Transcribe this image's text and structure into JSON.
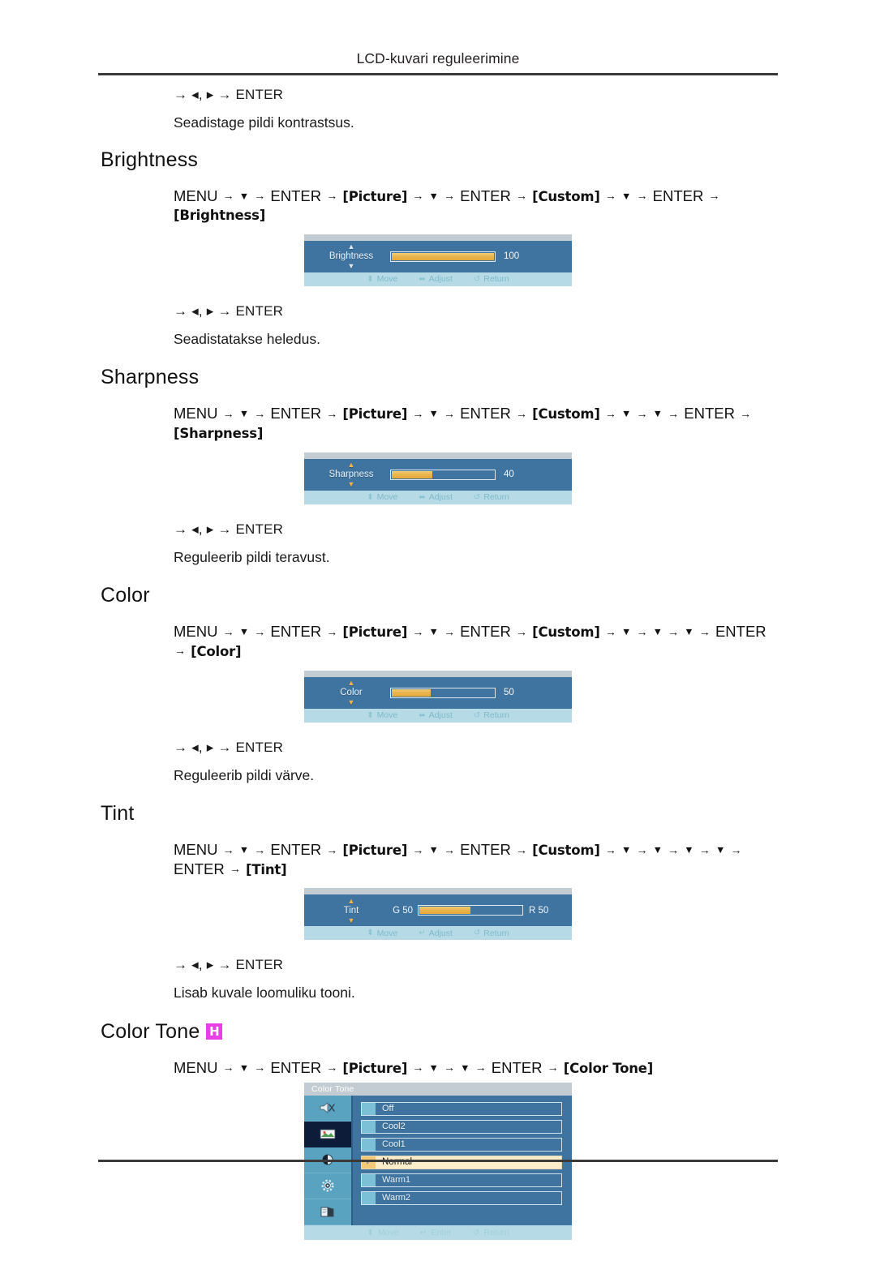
{
  "header": {
    "title": "LCD-kuvari reguleerimine"
  },
  "intro": {
    "keys": "→ ◂, ▸ → ENTER",
    "description": "Seadistage pildi kontrastsus."
  },
  "sections": [
    {
      "id": "brightness",
      "title": "Brightness",
      "badge": "",
      "path_tokens": [
        {
          "t": "MENU",
          "k": "plain"
        },
        {
          "t": "→",
          "k": "arrow"
        },
        {
          "t": "▼",
          "k": "tri"
        },
        {
          "t": "→",
          "k": "arrow"
        },
        {
          "t": "ENTER",
          "k": "plain"
        },
        {
          "t": "→",
          "k": "arrow"
        },
        {
          "t": "[Picture]",
          "k": "bracket"
        },
        {
          "t": "→",
          "k": "arrow"
        },
        {
          "t": "▼",
          "k": "tri"
        },
        {
          "t": "→",
          "k": "arrow"
        },
        {
          "t": "ENTER",
          "k": "plain"
        },
        {
          "t": "→",
          "k": "arrow"
        },
        {
          "t": "[Custom]",
          "k": "bracket"
        },
        {
          "t": "→",
          "k": "arrow"
        },
        {
          "t": "▼",
          "k": "tri"
        },
        {
          "t": "→",
          "k": "arrow"
        },
        {
          "t": "ENTER",
          "k": "plain"
        },
        {
          "t": "→",
          "k": "arrow"
        },
        {
          "t": "[Brightness]",
          "k": "bracket"
        }
      ],
      "osd": {
        "type": "slider",
        "label": "Brightness",
        "value": "100",
        "fill_percent": 100,
        "footer": [
          {
            "glyph": "⬍",
            "label": "Move"
          },
          {
            "glyph": "⬌",
            "label": "Adjust"
          },
          {
            "glyph": "↺",
            "label": "Return"
          }
        ]
      },
      "keys": "→ ◂, ▸ → ENTER",
      "description": "Seadistatakse heledus."
    },
    {
      "id": "sharpness",
      "title": "Sharpness",
      "badge": "",
      "path_tokens": [
        {
          "t": "MENU",
          "k": "plain"
        },
        {
          "t": "→",
          "k": "arrow"
        },
        {
          "t": "▼",
          "k": "tri"
        },
        {
          "t": "→",
          "k": "arrow"
        },
        {
          "t": "ENTER",
          "k": "plain"
        },
        {
          "t": "→",
          "k": "arrow"
        },
        {
          "t": "[Picture]",
          "k": "bracket"
        },
        {
          "t": "→",
          "k": "arrow"
        },
        {
          "t": "▼",
          "k": "tri"
        },
        {
          "t": "→",
          "k": "arrow"
        },
        {
          "t": "ENTER",
          "k": "plain"
        },
        {
          "t": "→",
          "k": "arrow"
        },
        {
          "t": "[Custom]",
          "k": "bracket"
        },
        {
          "t": "→",
          "k": "arrow"
        },
        {
          "t": "▼",
          "k": "tri"
        },
        {
          "t": "→",
          "k": "arrow"
        },
        {
          "t": "▼",
          "k": "tri"
        },
        {
          "t": "→",
          "k": "arrow"
        },
        {
          "t": "ENTER",
          "k": "plain"
        },
        {
          "t": "→",
          "k": "arrow"
        },
        {
          "t": "[Sharpness]",
          "k": "bracket"
        }
      ],
      "osd": {
        "type": "slider",
        "label": "Sharpness",
        "value": "40",
        "fill_percent": 40,
        "footer": [
          {
            "glyph": "⬍",
            "label": "Move"
          },
          {
            "glyph": "⬌",
            "label": "Adjust"
          },
          {
            "glyph": "↺",
            "label": "Return"
          }
        ]
      },
      "keys": "→ ◂, ▸ → ENTER",
      "description": "Reguleerib pildi teravust."
    },
    {
      "id": "color",
      "title": "Color",
      "badge": "",
      "path_tokens": [
        {
          "t": "MENU",
          "k": "plain"
        },
        {
          "t": "→",
          "k": "arrow"
        },
        {
          "t": "▼",
          "k": "tri"
        },
        {
          "t": "→",
          "k": "arrow"
        },
        {
          "t": "ENTER",
          "k": "plain"
        },
        {
          "t": "→",
          "k": "arrow"
        },
        {
          "t": "[Picture]",
          "k": "bracket"
        },
        {
          "t": "→",
          "k": "arrow"
        },
        {
          "t": "▼",
          "k": "tri"
        },
        {
          "t": "→",
          "k": "arrow"
        },
        {
          "t": "ENTER",
          "k": "plain"
        },
        {
          "t": "→",
          "k": "arrow"
        },
        {
          "t": "[Custom]",
          "k": "bracket"
        },
        {
          "t": "→",
          "k": "arrow"
        },
        {
          "t": "▼",
          "k": "tri"
        },
        {
          "t": "→",
          "k": "arrow"
        },
        {
          "t": "▼",
          "k": "tri"
        },
        {
          "t": "→",
          "k": "arrow"
        },
        {
          "t": "▼",
          "k": "tri"
        },
        {
          "t": "→",
          "k": "arrow"
        },
        {
          "t": "ENTER",
          "k": "plain"
        },
        {
          "t": "→",
          "k": "arrow"
        },
        {
          "t": "[Color]",
          "k": "bracket"
        }
      ],
      "osd": {
        "type": "slider",
        "label": "Color",
        "value": "50",
        "fill_percent": 38,
        "footer": [
          {
            "glyph": "⬍",
            "label": "Move"
          },
          {
            "glyph": "⬌",
            "label": "Adjust"
          },
          {
            "glyph": "↺",
            "label": "Return"
          }
        ]
      },
      "keys": "→ ◂, ▸ → ENTER",
      "description": "Reguleerib pildi värve."
    },
    {
      "id": "tint",
      "title": "Tint",
      "badge": "",
      "path_tokens": [
        {
          "t": "MENU",
          "k": "plain"
        },
        {
          "t": "→",
          "k": "arrow"
        },
        {
          "t": "▼",
          "k": "tri"
        },
        {
          "t": "→",
          "k": "arrow"
        },
        {
          "t": "ENTER",
          "k": "plain"
        },
        {
          "t": "→",
          "k": "arrow"
        },
        {
          "t": "[Picture]",
          "k": "bracket"
        },
        {
          "t": "→",
          "k": "arrow"
        },
        {
          "t": "▼",
          "k": "tri"
        },
        {
          "t": "→",
          "k": "arrow"
        },
        {
          "t": "ENTER",
          "k": "plain"
        },
        {
          "t": "→",
          "k": "arrow"
        },
        {
          "t": "[Custom]",
          "k": "bracket"
        },
        {
          "t": "→",
          "k": "arrow"
        },
        {
          "t": "▼",
          "k": "tri"
        },
        {
          "t": "→",
          "k": "arrow"
        },
        {
          "t": "▼",
          "k": "tri"
        },
        {
          "t": "→",
          "k": "arrow"
        },
        {
          "t": "▼",
          "k": "tri"
        },
        {
          "t": "→",
          "k": "arrow"
        },
        {
          "t": "▼",
          "k": "tri"
        },
        {
          "t": "→",
          "k": "arrow"
        },
        {
          "t": "ENTER",
          "k": "plain"
        },
        {
          "t": "→",
          "k": "arrow"
        },
        {
          "t": "[Tint]",
          "k": "bracket"
        }
      ],
      "osd": {
        "type": "dual-slider",
        "label": "Tint",
        "left_label": "G 50",
        "right_label": "R 50",
        "fill_percent": 50,
        "footer": [
          {
            "glyph": "⬍",
            "label": "Move"
          },
          {
            "glyph": "↵",
            "label": "Adjust"
          },
          {
            "glyph": "↺",
            "label": "Return"
          }
        ]
      },
      "keys": "→ ◂, ▸ → ENTER",
      "description": "Lisab kuvale loomuliku tooni."
    },
    {
      "id": "color-tone",
      "title": "Color Tone",
      "badge": "H",
      "badge_color": "#e83fe8",
      "path_tokens": [
        {
          "t": "MENU",
          "k": "plain"
        },
        {
          "t": "→",
          "k": "arrow"
        },
        {
          "t": "▼",
          "k": "tri"
        },
        {
          "t": "→",
          "k": "arrow"
        },
        {
          "t": "ENTER",
          "k": "plain"
        },
        {
          "t": "→",
          "k": "arrow"
        },
        {
          "t": "[Picture]",
          "k": "bracket"
        },
        {
          "t": "→",
          "k": "arrow"
        },
        {
          "t": "▼",
          "k": "tri"
        },
        {
          "t": "→",
          "k": "arrow"
        },
        {
          "t": "▼",
          "k": "tri"
        },
        {
          "t": "→",
          "k": "arrow"
        },
        {
          "t": "ENTER",
          "k": "plain"
        },
        {
          "t": "→",
          "k": "arrow"
        },
        {
          "t": "[Color Tone]",
          "k": "bracket"
        }
      ],
      "osd": {
        "type": "menu",
        "title": "Color Tone",
        "rail_icons": [
          {
            "name": "speaker-mute-icon",
            "selected": false
          },
          {
            "name": "picture-icon",
            "selected": true
          },
          {
            "name": "contrast-icon",
            "selected": false
          },
          {
            "name": "setup-gear-icon",
            "selected": false
          },
          {
            "name": "multimedia-book-icon",
            "selected": false
          }
        ],
        "options": [
          {
            "label": "Off",
            "selected": false
          },
          {
            "label": "Cool2",
            "selected": false
          },
          {
            "label": "Cool1",
            "selected": false
          },
          {
            "label": "Normal",
            "selected": true
          },
          {
            "label": "Warm1",
            "selected": false
          },
          {
            "label": "Warm2",
            "selected": false
          }
        ],
        "footer": [
          {
            "glyph": "⬍",
            "label": "Move"
          },
          {
            "glyph": "↵",
            "label": "Enter"
          },
          {
            "glyph": "↺",
            "label": "Return"
          }
        ]
      },
      "keys": "",
      "description": ""
    }
  ],
  "colors": {
    "osd_body": "#3f74a0",
    "osd_footer": "#b6dbe6",
    "osd_titlebar": "#c3ccd2",
    "slider_fill": "#e9b551",
    "menu_selected_row": "#fdecc9",
    "rail_icon_bg": "#59a3c0",
    "rail_icon_selected_bg": "#0d1c38",
    "badge_h": "#e83fe8"
  }
}
